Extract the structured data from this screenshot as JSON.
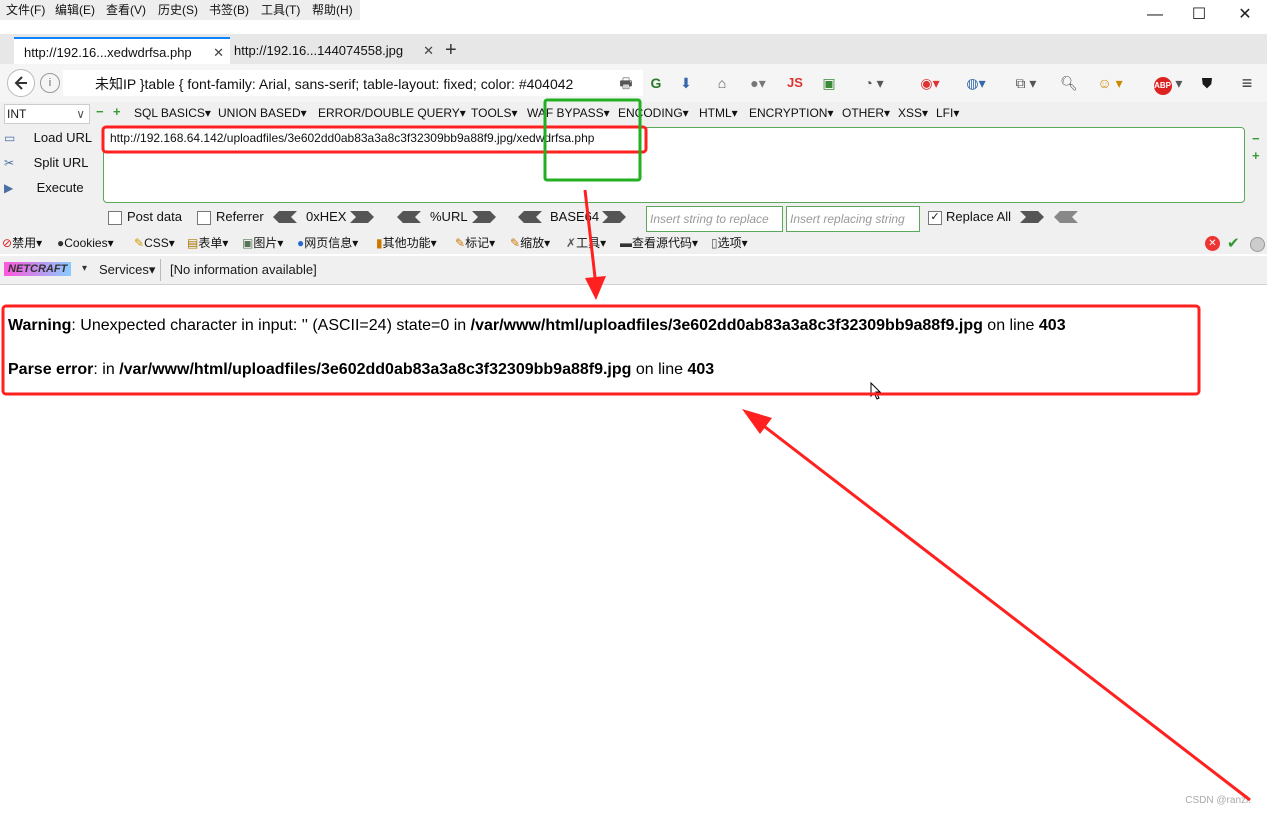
{
  "menubar": {
    "items": [
      "文件(F)",
      "编辑(E)",
      "查看(V)",
      "历史(S)",
      "书签(B)",
      "工具(T)",
      "帮助(H)"
    ],
    "window_buttons": [
      "—",
      "☐",
      "✕"
    ]
  },
  "tabs": [
    {
      "label": "http://192.16...xedwdrfsa.php",
      "active": true
    },
    {
      "label": "http://192.16...144074558.jpg",
      "active": false
    }
  ],
  "new_tab": "+",
  "navbar": {
    "address_text": "未知IP   }table { font-family: Arial, sans-serif; table-layout: fixed; color: #404042",
    "icons": {
      "js": "JS",
      "abp": "ABP"
    }
  },
  "hackbar": {
    "select_value": "INT",
    "menus": [
      "SQL BASICS▾",
      "UNION BASED▾",
      "ERROR/DOUBLE QUERY▾",
      "TOOLS▾",
      "WAF BYPASS▾",
      "ENCODING▾",
      "HTML▾",
      "ENCRYPTION▾",
      "OTHER▾",
      "XSS▾",
      "LFI▾"
    ],
    "load_url": "Load URL",
    "split_url": "Split URL",
    "execute": "Execute",
    "url": "http://192.168.64.142/uploadfiles/3e602dd0ab83a3a8c3f32309bb9a88f9.jpg/xedwdrfsa.php",
    "post_data": "Post data",
    "referrer": "Referrer",
    "hex": "0xHEX",
    "url_enc": "%URL",
    "base64": "BASE64",
    "insert_string_placeholder": "Insert string to replace",
    "insert_replacing_placeholder": "Insert replacing string",
    "replace_all": "Replace All"
  },
  "webdev": {
    "items": [
      "禁用▾",
      "Cookies▾",
      "CSS▾",
      "表单▾",
      "图片▾",
      "网页信息▾",
      "其他功能▾",
      "标记▾",
      "缩放▾",
      "工具▾",
      "查看源代码▾",
      "选项▾"
    ]
  },
  "netcraft": {
    "logo": "NETCRAFT",
    "services": "Services▾",
    "info": "[No information available]"
  },
  "content": {
    "warning_label": "Warning",
    "warning_text": ": Unexpected character in input: '' (ASCII=24) state=0 in ",
    "warning_path": "/var/www/html/uploadfiles/3e602dd0ab83a3a8c3f32309bb9a88f9.jpg",
    "on_line": " on line ",
    "line_no": "403",
    "parse_label": "Parse error",
    "parse_text": ": in ",
    "parse_path": "/var/www/html/uploadfiles/3e602dd0ab83a3a8c3f32309bb9a88f9.jpg"
  },
  "watermark": "CSDN @ranzi.",
  "colors": {
    "annotation_red": "#ff2020",
    "annotation_green": "#22b022",
    "tab_accent": "#0a84ff"
  }
}
